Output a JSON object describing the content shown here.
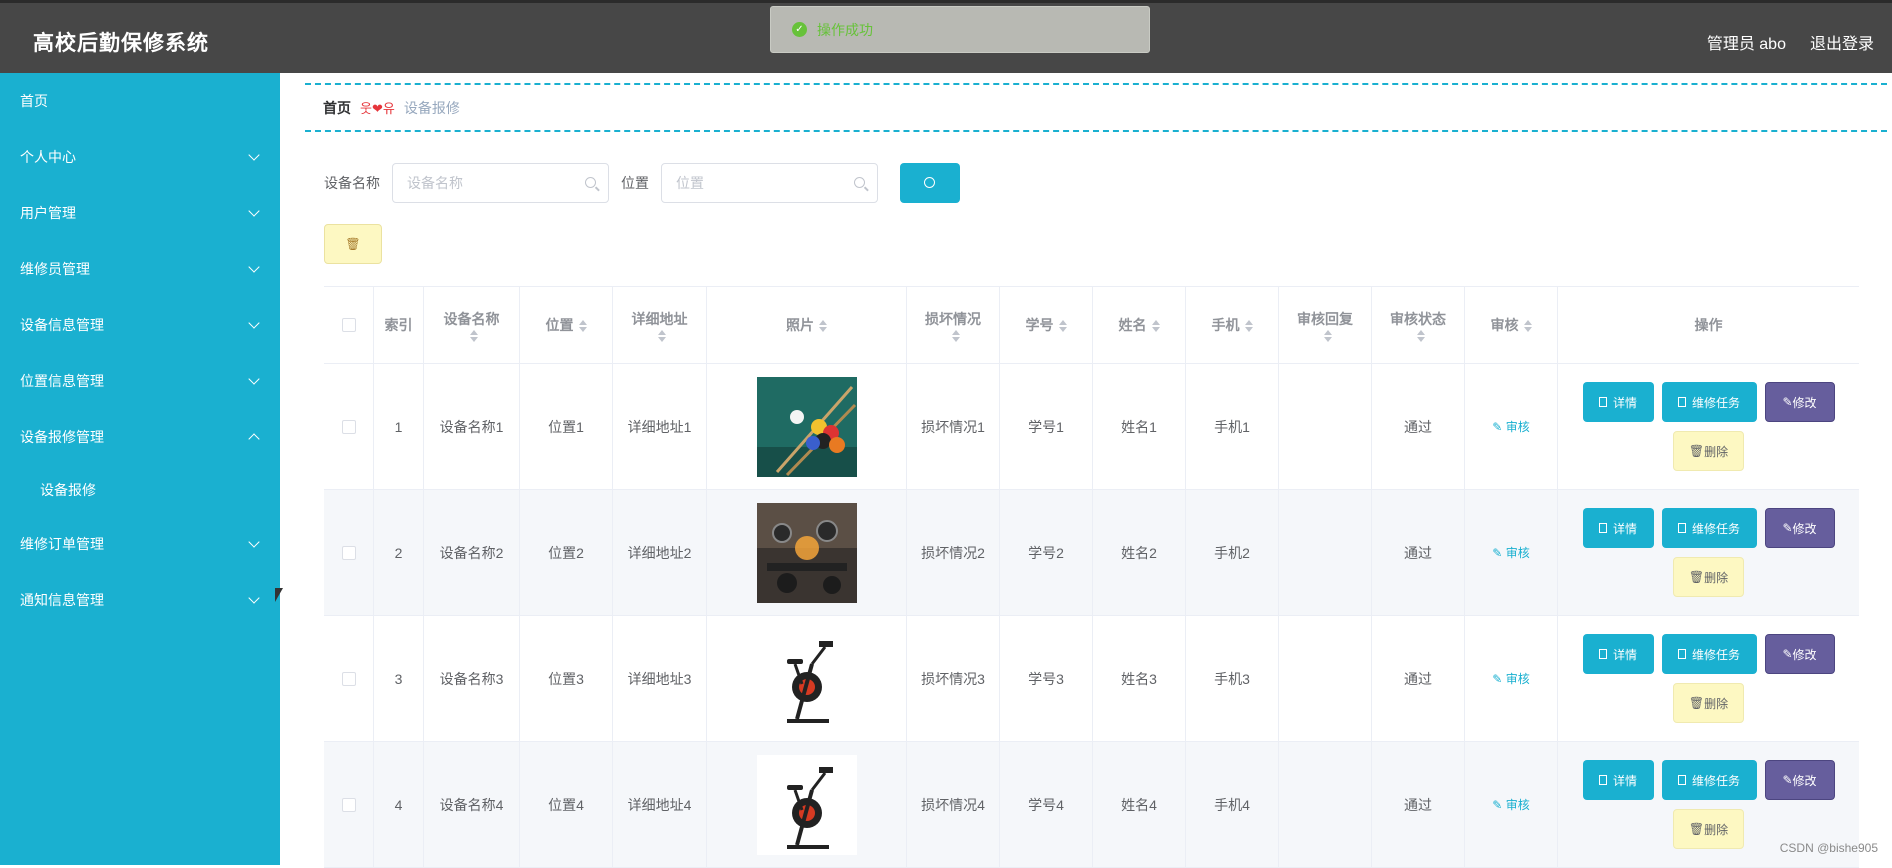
{
  "header": {
    "title": "高校后勤保修系统",
    "user": "管理员 abo",
    "logout": "退出登录"
  },
  "toast": {
    "message": "操作成功"
  },
  "sidebar": {
    "items": [
      {
        "label": "首页"
      },
      {
        "label": "个人中心"
      },
      {
        "label": "用户管理"
      },
      {
        "label": "维修员管理"
      },
      {
        "label": "设备信息管理"
      },
      {
        "label": "位置信息管理"
      },
      {
        "label": "设备报修管理"
      },
      {
        "label": "设备报修"
      },
      {
        "label": "维修订单管理"
      },
      {
        "label": "通知信息管理"
      }
    ]
  },
  "breadcrumb": {
    "home": "首页",
    "separator": "웃❤유",
    "current": "设备报修"
  },
  "search": {
    "name_label": "设备名称",
    "name_placeholder": "设备名称",
    "location_label": "位置",
    "location_placeholder": "位置"
  },
  "table": {
    "columns": [
      "索引",
      "设备名称",
      "位置",
      "详细地址",
      "照片",
      "损坏情况",
      "学号",
      "姓名",
      "手机",
      "审核回复",
      "审核状态",
      "审核",
      "操作"
    ],
    "rows": [
      {
        "index": "1",
        "name": "设备名称1",
        "location": "位置1",
        "address": "详细地址1",
        "photo": "billiards",
        "damage": "损坏情况1",
        "student_id": "学号1",
        "person": "姓名1",
        "phone": "手机1",
        "reply": "",
        "status": "通过",
        "audit": "审核"
      },
      {
        "index": "2",
        "name": "设备名称2",
        "location": "位置2",
        "address": "详细地址2",
        "photo": "gym",
        "damage": "损坏情况2",
        "student_id": "学号2",
        "person": "姓名2",
        "phone": "手机2",
        "reply": "",
        "status": "通过",
        "audit": "审核"
      },
      {
        "index": "3",
        "name": "设备名称3",
        "location": "位置3",
        "address": "详细地址3",
        "photo": "spin-bike",
        "damage": "损坏情况3",
        "student_id": "学号3",
        "person": "姓名3",
        "phone": "手机3",
        "reply": "",
        "status": "通过",
        "audit": "审核"
      },
      {
        "index": "4",
        "name": "设备名称4",
        "location": "位置4",
        "address": "详细地址4",
        "photo": "spin-bike",
        "damage": "损坏情况4",
        "student_id": "学号4",
        "person": "姓名4",
        "phone": "手机4",
        "reply": "",
        "status": "通过",
        "audit": "审核"
      }
    ],
    "actions": {
      "detail": "详情",
      "task": "维修任务",
      "edit": "修改",
      "delete": "删除"
    }
  },
  "watermark": "CSDN @bishe905"
}
